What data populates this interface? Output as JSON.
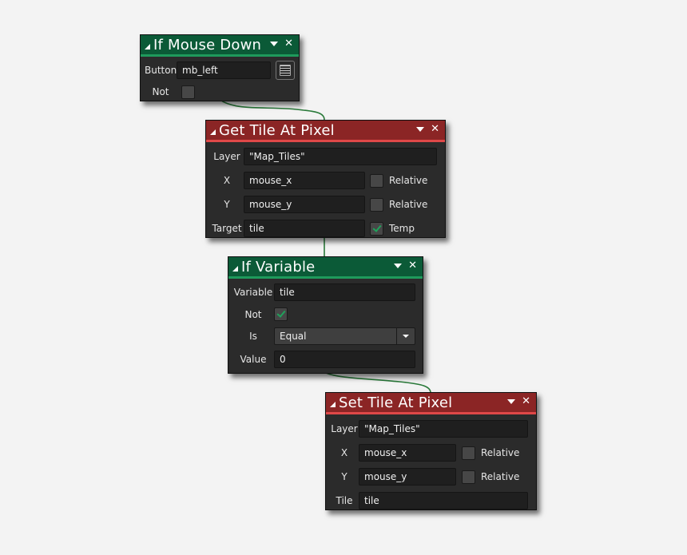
{
  "colors": {
    "canvas_background": "#f3f3f3",
    "node_body": "#2b2b2b",
    "condition_header": "#0b5a37",
    "condition_accent": "#1e9a5c",
    "action_header": "#8b2525",
    "action_accent": "#e04848",
    "wire": "#2a7a3a",
    "checkmark": "#1fa35b"
  },
  "nodes": {
    "if_mouse_down": {
      "title": "If Mouse Down",
      "kind": "condition",
      "icons": [
        "collapse-icon",
        "menu-icon",
        "close-icon",
        "list-picker-icon"
      ],
      "fields": {
        "button": {
          "label": "Button",
          "value": "mb_left"
        },
        "not": {
          "label": "Not",
          "checked": false
        }
      }
    },
    "get_tile_at_pixel": {
      "title": "Get Tile At Pixel",
      "kind": "action",
      "fields": {
        "layer": {
          "label": "Layer",
          "value": "\"Map_Tiles\""
        },
        "x": {
          "label": "X",
          "value": "mouse_x",
          "relative_label": "Relative",
          "relative": false
        },
        "y": {
          "label": "Y",
          "value": "mouse_y",
          "relative_label": "Relative",
          "relative": false
        },
        "target": {
          "label": "Target",
          "value": "tile",
          "temp_label": "Temp",
          "temp": true
        }
      }
    },
    "if_variable": {
      "title": "If Variable",
      "kind": "condition",
      "fields": {
        "variable": {
          "label": "Variable",
          "value": "tile"
        },
        "not": {
          "label": "Not",
          "checked": true
        },
        "is": {
          "label": "Is",
          "value": "Equal"
        },
        "value": {
          "label": "Value",
          "value": "0"
        }
      }
    },
    "set_tile_at_pixel": {
      "title": "Set Tile At Pixel",
      "kind": "action",
      "fields": {
        "layer": {
          "label": "Layer",
          "value": "\"Map_Tiles\""
        },
        "x": {
          "label": "X",
          "value": "mouse_x",
          "relative_label": "Relative",
          "relative": false
        },
        "y": {
          "label": "Y",
          "value": "mouse_y",
          "relative_label": "Relative",
          "relative": false
        },
        "tile": {
          "label": "Tile",
          "value": "tile"
        }
      }
    }
  }
}
